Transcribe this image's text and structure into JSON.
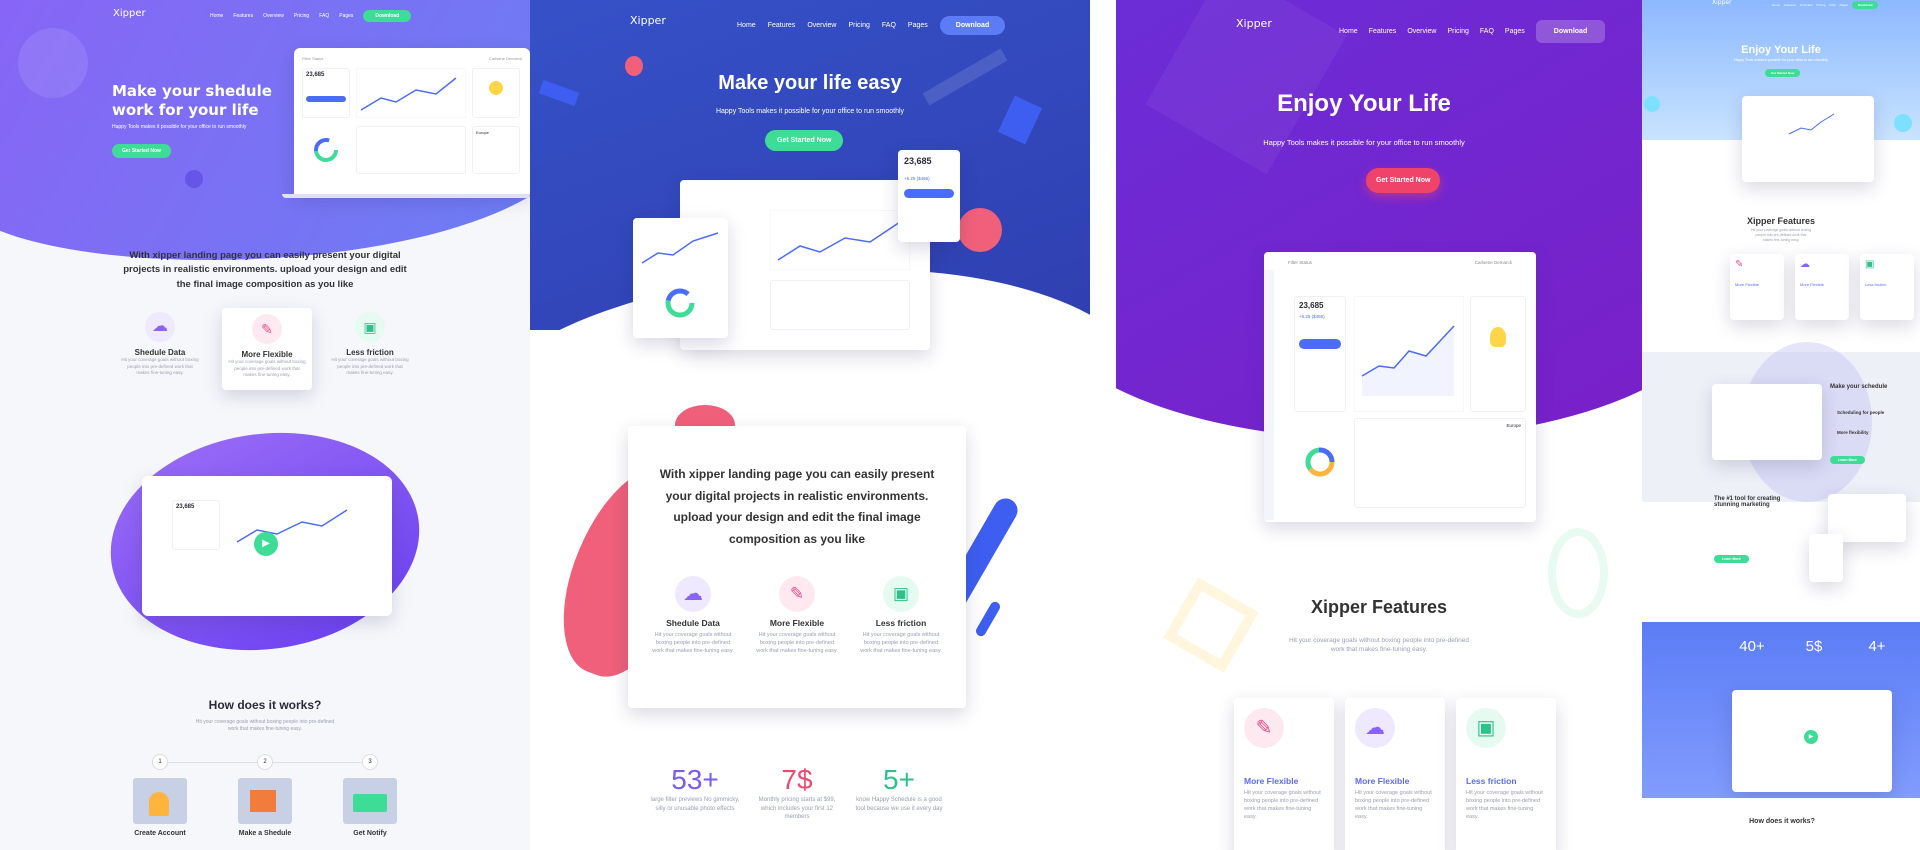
{
  "logo": "Xipper",
  "nav": [
    "Home",
    "Features",
    "Overview",
    "Pricing",
    "FAQ",
    "Pages"
  ],
  "download": "Download",
  "cta": "Get Started Now",
  "cta_short": "Get Started Now",
  "dashboard": {
    "amount": "23,685",
    "change": "+5.25 ($456)",
    "region": "Europe",
    "owner": "Carlsene Demarck",
    "filter": "Filter Status"
  },
  "p1": {
    "hero": "Make your shedule work for your life",
    "sub": "Happy Tools makes it possible for your office to run smoothly",
    "intro": "With xipper landing page you can easily present your digital projects in realistic environments. upload your design and edit the final image composition as you like",
    "features": [
      {
        "t": "Shedule Data"
      },
      {
        "t": "More Flexible"
      },
      {
        "t": "Less friction"
      }
    ],
    "feat_desc": "Hit your coverage goals without boxing people into pre-defined work that makes fine-tuning easy.",
    "how": "How does it works?",
    "how_sub": "Hit your coverage goals without boxing people into pre-defined work that makes fine-tuning easy.",
    "steps": [
      {
        "n": "1",
        "t": "Create Account"
      },
      {
        "n": "2",
        "t": "Make a Shedule"
      },
      {
        "n": "3",
        "t": "Get Notify"
      }
    ]
  },
  "p2": {
    "hero": "Make your life easy",
    "sub": "Happy Tools makes it possible for your office to run smoothly",
    "intro": "With xipper landing page you can easily present your digital projects in realistic environments. upload your design and edit the final image composition as you like",
    "features": [
      {
        "t": "Shedule Data"
      },
      {
        "t": "More Flexible"
      },
      {
        "t": "Less friction"
      }
    ],
    "feat_desc": "Hit your coverage goals without boxing people into pre-defined work that makes fine-tuning easy.",
    "stats": [
      {
        "v": "53+",
        "d": "large filter previews No gimmicky, silly or unusable photo effects"
      },
      {
        "v": "7$",
        "d": "Monthly pricing starts at $99, which includes your first 12 members"
      },
      {
        "v": "5+",
        "d": "know Happy Schedule is a good tool because we use it every day"
      }
    ]
  },
  "p3": {
    "hero": "Enjoy Your Life",
    "sub": "Happy Tools makes it possible for your office to run smoothly",
    "features_title": "Xipper Features",
    "features_sub": "Hit your coverage goals without boxing people into pre-defined work that makes fine-tuning easy.",
    "cards": [
      {
        "t": "More Flexible"
      },
      {
        "t": "More Flexible"
      },
      {
        "t": "Less friction"
      }
    ],
    "card_desc": "Hit your coverage goals without boxing people into pre-defined work that makes fine-tuning easy."
  },
  "p4": {
    "hero": "Enjoy Your Life",
    "sub": "Happy Tools makes it possible for your office to run smoothly",
    "features_title": "Xipper Features",
    "features_sub": "Hit your coverage goals without boxing people into pre-defined work that makes fine-tuning easy.",
    "cards": [
      {
        "t": "More Flexible"
      },
      {
        "t": "More Flexible"
      },
      {
        "t": "Less friction"
      }
    ],
    "schedule": "Make your schedule",
    "scheduling": "Scheduling for people",
    "flex": "More flexibility",
    "tool": "The #1 tool for creating stunning marketing",
    "learn": "Learn More",
    "stats": [
      {
        "v": "40+"
      },
      {
        "v": "5$"
      },
      {
        "v": "4+"
      }
    ],
    "how": "How does it works?"
  }
}
